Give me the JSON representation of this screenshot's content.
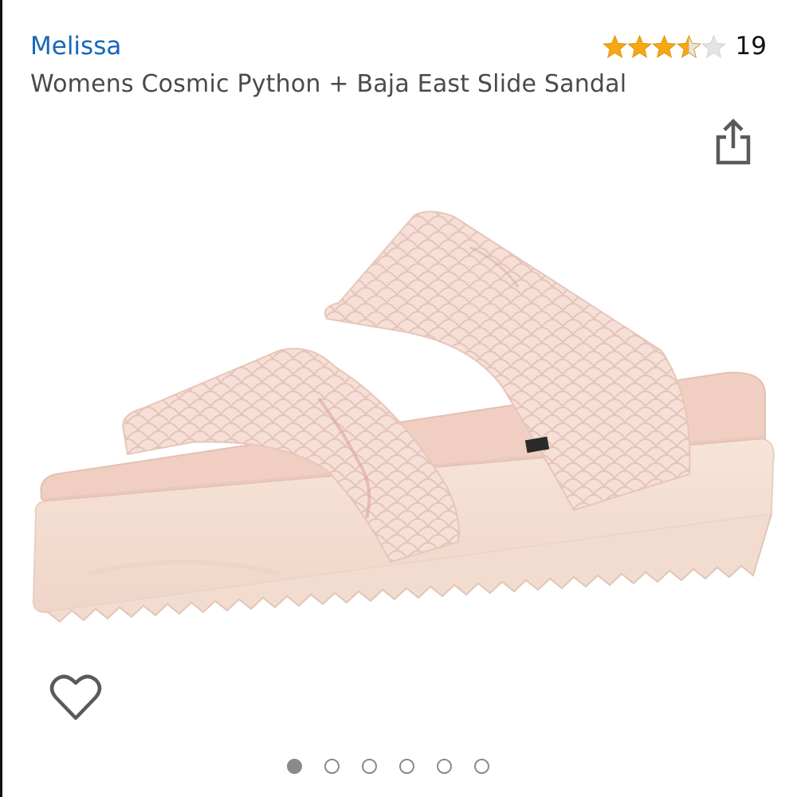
{
  "product": {
    "brand": "Melissa",
    "title": "Womens Cosmic Python + Baja East Slide Sandal",
    "image_alt": "Pale pink slide sandal with python texture straps"
  },
  "rating": {
    "stars": 3.5,
    "max": 5,
    "count": "19",
    "star_color": "#f4a815",
    "empty_color": "#e4e4e4"
  },
  "icons": {
    "share": "share-icon",
    "wishlist": "heart-outline-icon"
  },
  "carousel": {
    "total": 6,
    "active_index": 0
  },
  "colors": {
    "brand_link": "#1468b7",
    "title_text": "#4a4a4a"
  }
}
